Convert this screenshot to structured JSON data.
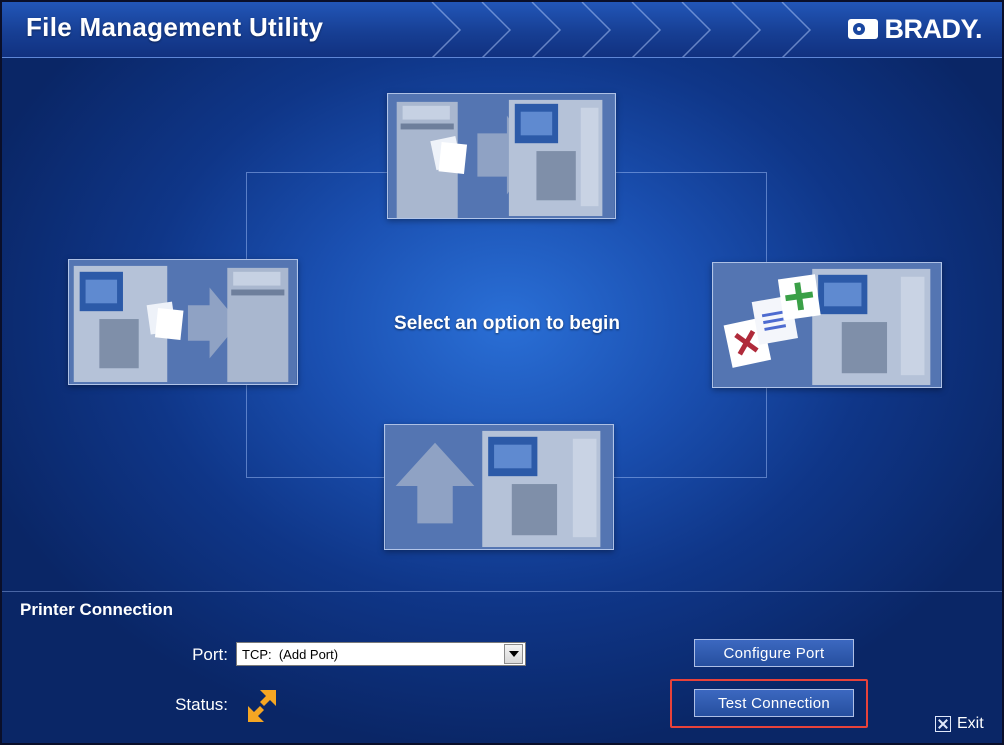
{
  "app": {
    "title": "File Management Utility",
    "logo_text": "BRADY."
  },
  "main": {
    "prompt": "Select an option to begin",
    "options": [
      {
        "id": "top",
        "icon": "printer-to-printer-transfer-icon"
      },
      {
        "id": "left",
        "icon": "printer-to-archive-transfer-icon"
      },
      {
        "id": "right",
        "icon": "manage-printer-files-icon"
      },
      {
        "id": "bottom",
        "icon": "upload-to-printer-icon"
      }
    ]
  },
  "connection": {
    "section_title": "Printer Connection",
    "port_label": "Port:",
    "port_value": "TCP:  (Add Port)",
    "status_label": "Status:",
    "status_icon": "disconnected-arrows-icon",
    "configure_button": "Configure Port",
    "test_button": "Test Connection",
    "exit_label": "Exit"
  },
  "colors": {
    "background": "#1a4fb0",
    "header": "#173f94",
    "highlight": "#e8423a",
    "status_icon": "#f5a623"
  }
}
